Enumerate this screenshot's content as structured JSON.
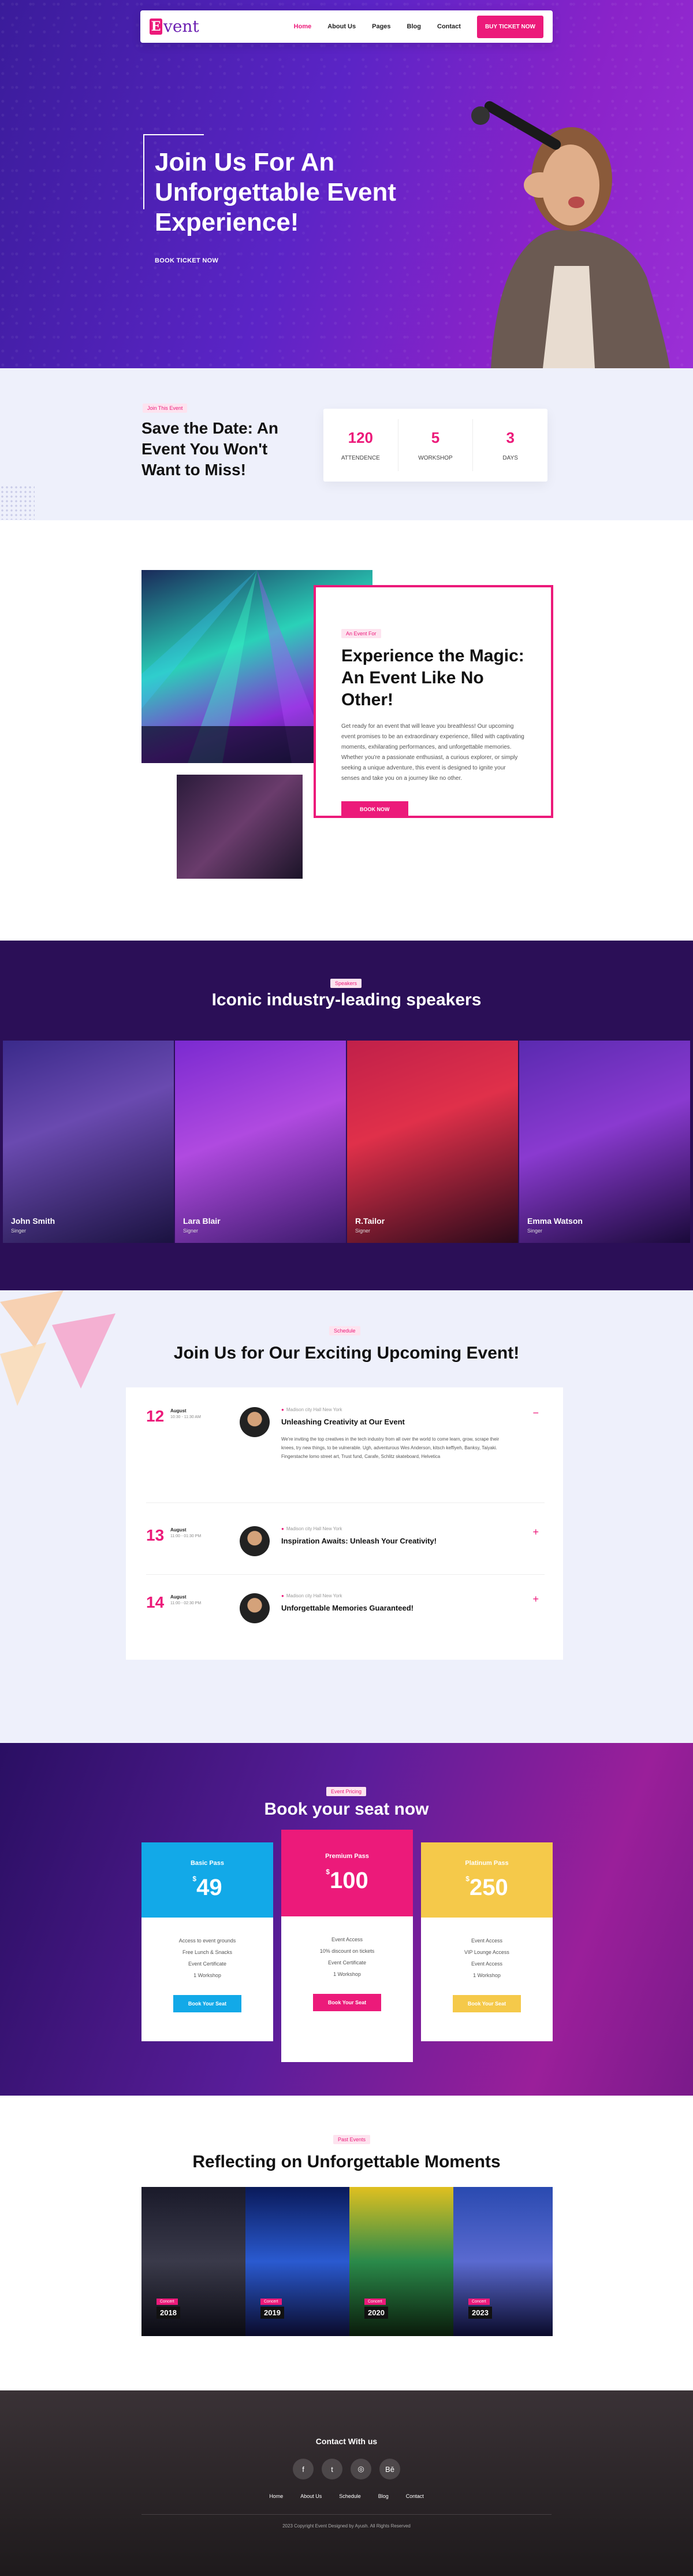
{
  "header": {
    "logo_letter": "E",
    "logo_word": "vent",
    "nav": [
      {
        "label": "Home",
        "active": true
      },
      {
        "label": "About Us"
      },
      {
        "label": "Pages"
      },
      {
        "label": "Blog"
      },
      {
        "label": "Contact"
      }
    ],
    "cta": "BUY TICKET NOW"
  },
  "hero": {
    "title": "Join Us For An Unforgettable Event Experience!",
    "button": "BOOK TICKET NOW"
  },
  "stats": {
    "tag": "Join This Event",
    "title": "Save the Date: An Event You Won't Want to Miss!",
    "items": [
      {
        "value": "120",
        "label": "ATTENDENCE"
      },
      {
        "value": "5",
        "label": "WORKSHOP"
      },
      {
        "value": "3",
        "label": "DAYS"
      }
    ]
  },
  "about": {
    "tag": "An Event For",
    "title": "Experience the Magic: An Event Like No Other!",
    "text": "Get ready for an event that will leave you breathless! Our upcoming event promises to be an extraordinary experience, filled with captivating moments, exhilarating performances, and unforgettable memories. Whether you're a passionate enthusiast, a curious explorer, or simply seeking a unique adventure, this event is designed to ignite your senses and take you on a journey like no other.",
    "button": "BOOK NOW"
  },
  "speakers": {
    "tag": "Speakers",
    "title": "Iconic industry-leading speakers",
    "items": [
      {
        "name": "John Smith",
        "role": "Singer"
      },
      {
        "name": "Lara Blair",
        "role": "Signer"
      },
      {
        "name": "R.Tailor",
        "role": "Signer"
      },
      {
        "name": "Emma Watson",
        "role": "Singer"
      }
    ]
  },
  "schedule": {
    "tag": "Schedule",
    "title": "Join Us for Our Exciting Upcoming Event!",
    "events": [
      {
        "day": "12",
        "month": "August",
        "time": "10:30 - 11:30 AM",
        "location": "Madison city Hall New York",
        "title": "Unleashing Creativity at Our Event",
        "desc": "We're inviting the top creatives in the tech industry from all over the world to come learn, grow, scrape their knees, try new things, to be vulnerable. Ugh, adventurous Wes Anderson, kitsch keffiyeh, Banksy, Taiyaki. Fingerstache lomo street art, Trust fund, Carafe, Schlitz skateboard, Helvetica",
        "toggle": "−"
      },
      {
        "day": "13",
        "month": "August",
        "time": "11:00 - 01:30 PM",
        "location": "Madison city Hall New York",
        "title": "Inspiration Awaits: Unleash Your Creativity!",
        "toggle": "+"
      },
      {
        "day": "14",
        "month": "August",
        "time": "11:00 - 02:30 PM",
        "location": "Madison city Hall New York",
        "title": "Unforgettable Memories Guaranteed!",
        "toggle": "+"
      }
    ]
  },
  "pricing": {
    "tag": "Event Pricing",
    "title": "Book your seat now",
    "plans": [
      {
        "name": "Basic Pass",
        "currency": "$",
        "price": "49",
        "color": "#12a9e8",
        "features": [
          "Access to event grounds",
          "Free Lunch & Snacks",
          "Event Certificate",
          "1 Workshop"
        ],
        "button": "Book Your Seat"
      },
      {
        "name": "Premium Pass",
        "currency": "$",
        "price": "100",
        "color": "#ec1a7a",
        "features": [
          "Event Access",
          "10% discount on tickets",
          "Event Certificate",
          "1 Workshop"
        ],
        "button": "Book Your Seat"
      },
      {
        "name": "Platinum Pass",
        "currency": "$",
        "price": "250",
        "color": "#f5c94a",
        "features": [
          "Event Access",
          "VIP Lounge Access",
          "Event Access",
          "1 Workshop"
        ],
        "button": "Book Your Seat"
      }
    ]
  },
  "gallery": {
    "tag": "Past Events",
    "title": "Reflecting on Unforgettable Moments",
    "items": [
      {
        "year": "2018",
        "category": "Concert"
      },
      {
        "year": "2019",
        "category": "Concert"
      },
      {
        "year": "2020",
        "category": "Concert"
      },
      {
        "year": "2023",
        "category": "Concert"
      }
    ]
  },
  "footer": {
    "title": "Contact With us",
    "socials": [
      {
        "name": "facebook-icon",
        "glyph": "f"
      },
      {
        "name": "twitter-icon",
        "glyph": "t"
      },
      {
        "name": "dribbble-icon",
        "glyph": "◎"
      },
      {
        "name": "behance-icon",
        "glyph": "Bē"
      }
    ],
    "nav": [
      "Home",
      "About Us",
      "Schedule",
      "Blog",
      "Contact"
    ],
    "copyright": "2023 Copyright Event Designed by Ayush. All Rights Reserved"
  }
}
